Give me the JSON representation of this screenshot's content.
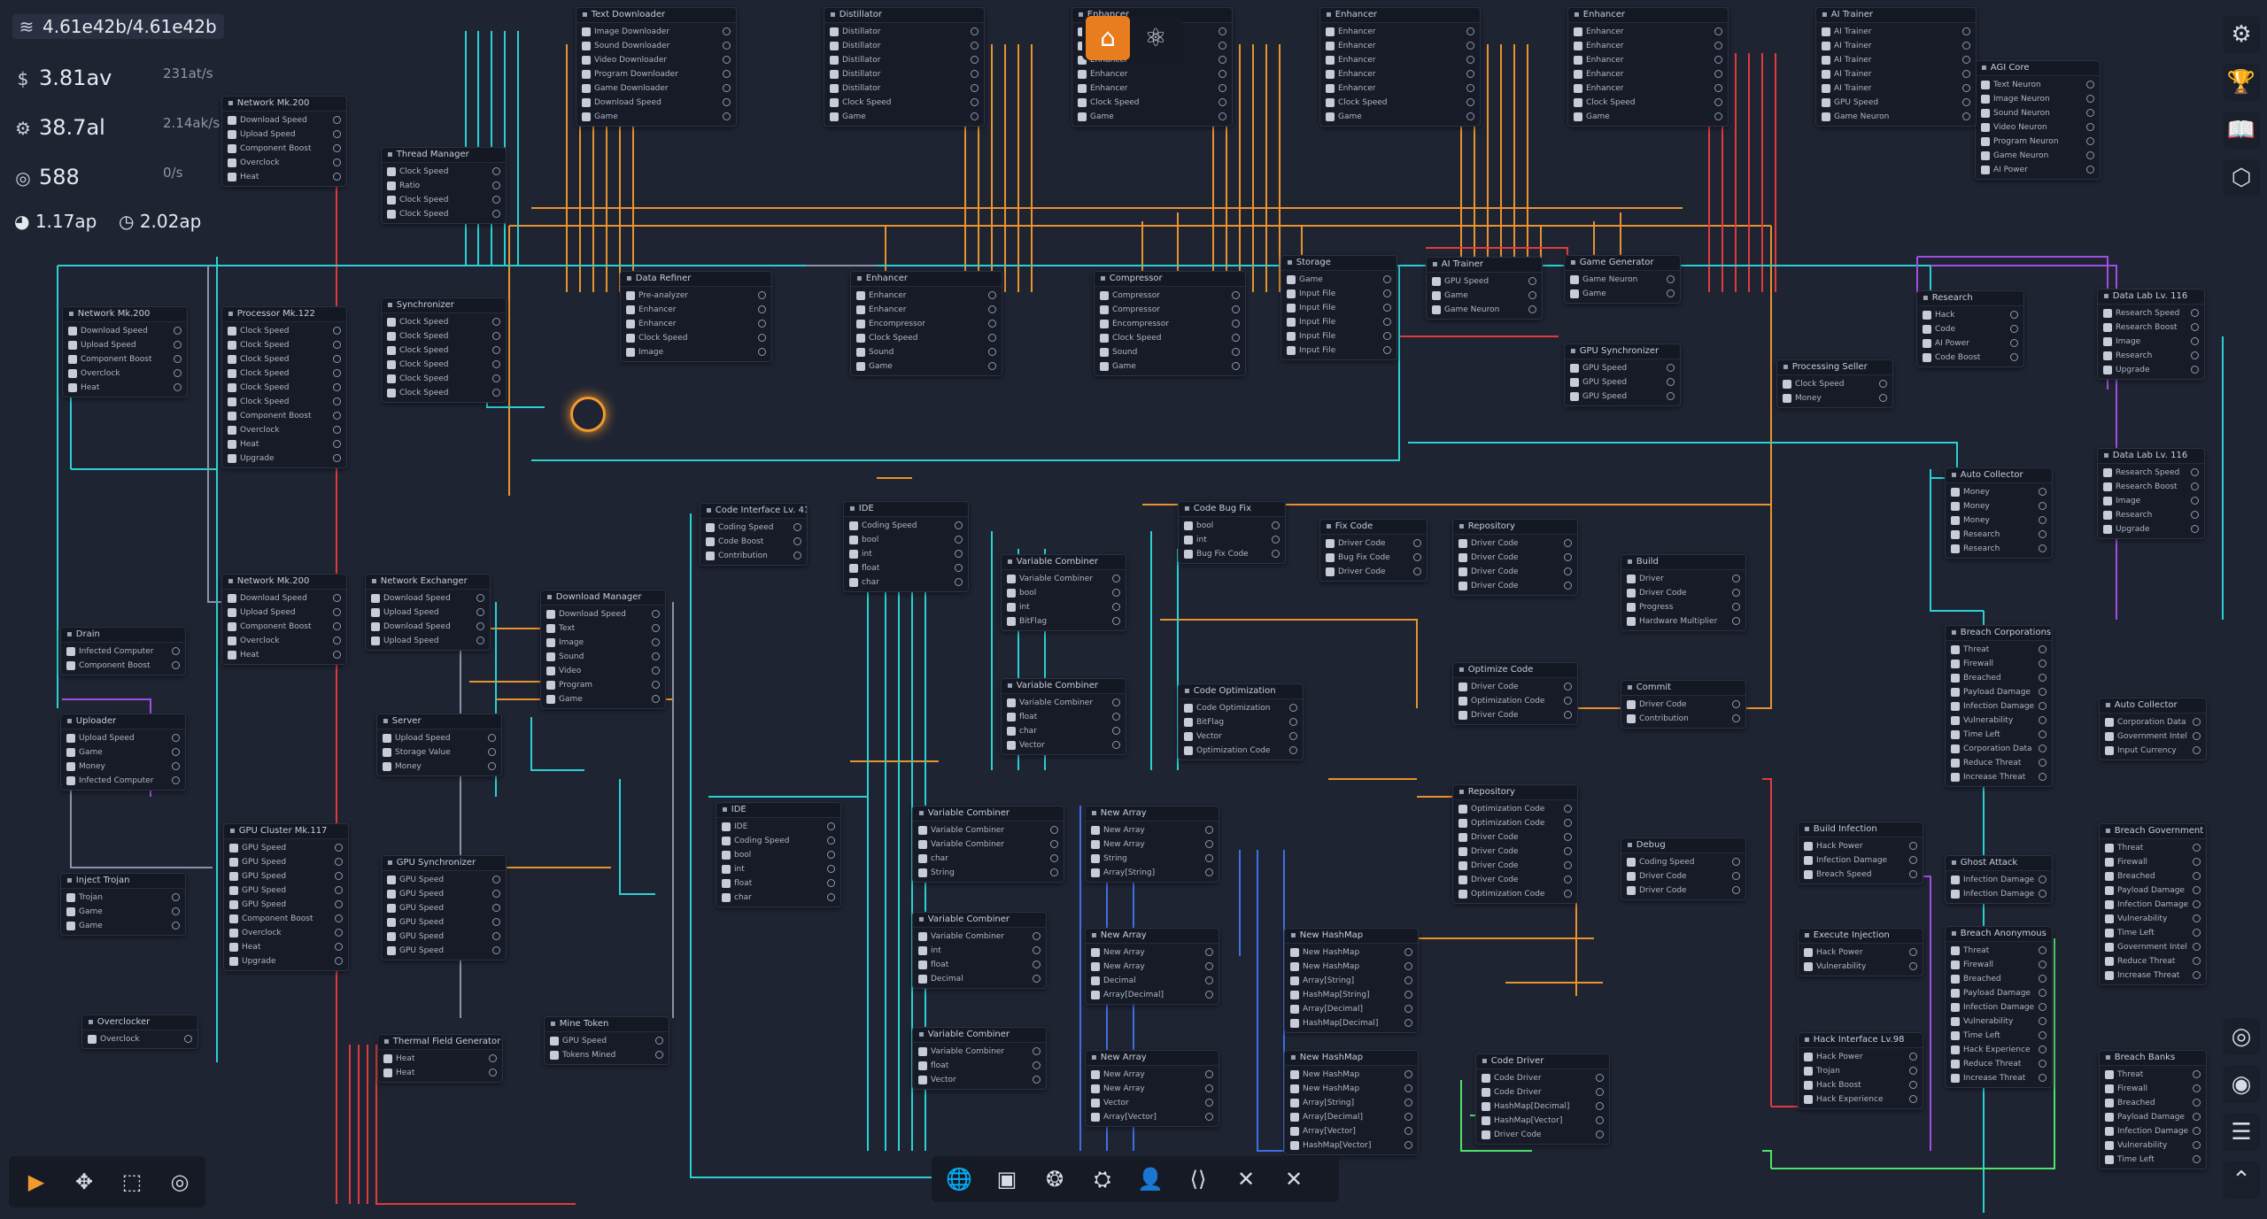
{
  "stats": {
    "data": {
      "value": "4.61e42b/4.61e42b",
      "icon": "layers-icon"
    },
    "money": {
      "value": "3.81av",
      "rate": "231at/s",
      "icon": "dollar-icon"
    },
    "research": {
      "value": "38.7al",
      "rate": "2.14ak/s",
      "icon": "gear-icon"
    },
    "tokens": {
      "value": "588",
      "rate": "0/s",
      "icon": "token-icon"
    },
    "processing": {
      "value": "1.17ap",
      "icon": "pie-icon"
    },
    "speed": {
      "value": "2.02ap",
      "icon": "clock-icon"
    }
  },
  "top_nav": [
    {
      "name": "home",
      "glyph": "⌂",
      "active": true
    },
    {
      "name": "atom",
      "glyph": "⚛",
      "active": false
    }
  ],
  "right_sidebar": [
    {
      "name": "settings-icon",
      "glyph": "⚙"
    },
    {
      "name": "trophy-icon",
      "glyph": "🏆"
    },
    {
      "name": "book-icon",
      "glyph": "📖"
    },
    {
      "name": "hexagon-icon",
      "glyph": "⬡"
    }
  ],
  "right_sidebar_bottom": [
    {
      "name": "orbit-icon",
      "glyph": "◎"
    },
    {
      "name": "target-icon",
      "glyph": "◉"
    },
    {
      "name": "stack-icon",
      "glyph": "☰"
    },
    {
      "name": "chevrons-up-icon",
      "glyph": "⌃"
    }
  ],
  "tools": [
    {
      "name": "select-tool",
      "glyph": "▶",
      "active": true
    },
    {
      "name": "move-tool",
      "glyph": "✥",
      "active": false
    },
    {
      "name": "marquee-tool",
      "glyph": "⬚",
      "active": false
    },
    {
      "name": "target-tool",
      "glyph": "◎",
      "active": false
    }
  ],
  "categories": [
    {
      "name": "globe-icon",
      "glyph": "🌐"
    },
    {
      "name": "chip-icon",
      "glyph": "▣"
    },
    {
      "name": "brain-icon",
      "glyph": "❂"
    },
    {
      "name": "satellite-icon",
      "glyph": "⛭"
    },
    {
      "name": "user-icon",
      "glyph": "👤"
    },
    {
      "name": "code-icon",
      "glyph": "⟨⟩"
    },
    {
      "name": "tools-icon",
      "glyph": "✕"
    },
    {
      "name": "close-icon",
      "glyph": "✕"
    }
  ],
  "nodes": [
    {
      "title": "Network Mk.200",
      "rows": [
        "Download Speed",
        "Upload Speed",
        "Component Boost",
        "Overclock",
        "Heat"
      ]
    },
    {
      "title": "Thread Manager",
      "rows": [
        "Clock Speed",
        "Ratio",
        "Clock Speed",
        "Clock Speed"
      ]
    },
    {
      "title": "Network Mk.200",
      "rows": [
        "Download Speed",
        "Upload Speed",
        "Component Boost",
        "Overclock",
        "Heat"
      ]
    },
    {
      "title": "Processor Mk.122",
      "rows": [
        "Clock Speed",
        "Clock Speed",
        "Clock Speed",
        "Clock Speed",
        "Clock Speed",
        "Clock Speed",
        "Component Boost",
        "Overclock",
        "Heat",
        "Upgrade"
      ]
    },
    {
      "title": "Synchronizer",
      "rows": [
        "Clock Speed",
        "Clock Speed",
        "Clock Speed",
        "Clock Speed",
        "Clock Speed",
        "Clock Speed"
      ]
    },
    {
      "title": "Network Mk.200",
      "rows": [
        "Download Speed",
        "Upload Speed",
        "Component Boost",
        "Overclock",
        "Heat"
      ]
    },
    {
      "title": "Network Exchanger",
      "rows": [
        "Download Speed",
        "Upload Speed",
        "Download Speed",
        "Upload Speed"
      ]
    },
    {
      "title": "Drain",
      "rows": [
        "Infected Computer",
        "Component Boost"
      ]
    },
    {
      "title": "Server",
      "rows": [
        "Upload Speed",
        "Storage Value",
        "Money"
      ]
    },
    {
      "title": "Uploader",
      "rows": [
        "Upload Speed",
        "Game",
        "Money",
        "Infected Computer"
      ]
    },
    {
      "title": "Download Manager",
      "rows": [
        "Download Speed",
        "Text",
        "Image",
        "Sound",
        "Video",
        "Program",
        "Game"
      ]
    },
    {
      "title": "GPU Cluster Mk.117",
      "rows": [
        "GPU Speed",
        "GPU Speed",
        "GPU Speed",
        "GPU Speed",
        "GPU Speed",
        "Component Boost",
        "Overclock",
        "Heat",
        "Upgrade"
      ]
    },
    {
      "title": "GPU Synchronizer",
      "rows": [
        "GPU Speed",
        "GPU Speed",
        "GPU Speed",
        "GPU Speed",
        "GPU Speed",
        "GPU Speed"
      ]
    },
    {
      "title": "Inject Trojan",
      "rows": [
        "Trojan",
        "Game",
        "Game"
      ]
    },
    {
      "title": "Overclocker",
      "rows": [
        "Overclock"
      ]
    },
    {
      "title": "Mine Token",
      "rows": [
        "GPU Speed",
        "Tokens Mined"
      ]
    },
    {
      "title": "Thermal Field Generator",
      "rows": [
        "Heat",
        "Heat"
      ]
    },
    {
      "title": "Data Refiner",
      "rows": [
        "Pre-analyzer",
        "Enhancer",
        "Enhancer",
        "Clock Speed",
        "Image"
      ]
    },
    {
      "title": "Enhancer",
      "rows": [
        "Enhancer",
        "Enhancer",
        "Encompressor",
        "Clock Speed",
        "Sound",
        "Game"
      ]
    },
    {
      "title": "Compressor",
      "rows": [
        "Compressor",
        "Compressor",
        "Encompressor",
        "Clock Speed",
        "Sound",
        "Game"
      ]
    },
    {
      "title": "Storage",
      "rows": [
        "Game",
        "Input File",
        "Input File",
        "Input File",
        "Input File",
        "Input File"
      ]
    },
    {
      "title": "AI Trainer",
      "rows": [
        "GPU Speed",
        "Game",
        "Game Neuron"
      ]
    },
    {
      "title": "Game Generator",
      "rows": [
        "Game Neuron",
        "Game"
      ]
    },
    {
      "title": "GPU Synchronizer",
      "rows": [
        "GPU Speed",
        "GPU Speed",
        "GPU Speed"
      ]
    },
    {
      "title": "Processing Seller",
      "rows": [
        "Clock Speed",
        "Money"
      ]
    },
    {
      "title": "Research",
      "rows": [
        "Hack",
        "Code",
        "AI Power",
        "Code Boost"
      ]
    },
    {
      "title": "Data Lab Lv. 116",
      "rows": [
        "Research Speed",
        "Research Boost",
        "Image",
        "Research",
        "Upgrade"
      ]
    },
    {
      "title": "Data Lab Lv. 116",
      "rows": [
        "Research Speed",
        "Research Boost",
        "Image",
        "Research",
        "Upgrade"
      ]
    },
    {
      "title": "AGI Core",
      "rows": [
        "Text Neuron",
        "Image Neuron",
        "Sound Neuron",
        "Video Neuron",
        "Program Neuron",
        "Game Neuron",
        "AI Power"
      ]
    },
    {
      "title": "Text Downloader",
      "rows": [
        "Image Downloader",
        "Sound Downloader",
        "Video Downloader",
        "Program Downloader",
        "Game Downloader",
        "Download Speed",
        "Game"
      ]
    },
    {
      "title": "Distillator",
      "rows": [
        "Distillator",
        "Distillator",
        "Distillator",
        "Distillator",
        "Distillator",
        "Clock Speed",
        "Game"
      ]
    },
    {
      "title": "Enhancer",
      "rows": [
        "Enhancer",
        "Enhancer",
        "Enhancer",
        "Enhancer",
        "Enhancer",
        "Clock Speed",
        "Game"
      ]
    },
    {
      "title": "Enhancer",
      "rows": [
        "Enhancer",
        "Enhancer",
        "Enhancer",
        "Enhancer",
        "Enhancer",
        "Clock Speed",
        "Game"
      ]
    },
    {
      "title": "Enhancer",
      "rows": [
        "Enhancer",
        "Enhancer",
        "Enhancer",
        "Enhancer",
        "Enhancer",
        "Clock Speed",
        "Game"
      ]
    },
    {
      "title": "AI Trainer",
      "rows": [
        "AI Trainer",
        "AI Trainer",
        "AI Trainer",
        "AI Trainer",
        "AI Trainer",
        "GPU Speed",
        "Game Neuron"
      ]
    },
    {
      "title": "Code Interface Lv. 41",
      "rows": [
        "Coding Speed",
        "Code Boost",
        "Contribution"
      ]
    },
    {
      "title": "IDE",
      "rows": [
        "Coding Speed",
        "bool",
        "int",
        "float",
        "char"
      ]
    },
    {
      "title": "Variable Combiner",
      "rows": [
        "Variable Combiner",
        "bool",
        "int",
        "BitFlag"
      ]
    },
    {
      "title": "Variable Combiner",
      "rows": [
        "Variable Combiner",
        "float",
        "char",
        "Vector"
      ]
    },
    {
      "title": "Code Bug Fix",
      "rows": [
        "bool",
        "int",
        "Bug Fix Code"
      ]
    },
    {
      "title": "Code Optimization",
      "rows": [
        "Code Optimization",
        "BitFlag",
        "Vector",
        "Optimization Code"
      ]
    },
    {
      "title": "Fix Code",
      "rows": [
        "Driver Code",
        "Bug Fix Code",
        "Driver Code"
      ]
    },
    {
      "title": "Repository",
      "rows": [
        "Driver Code",
        "Driver Code",
        "Driver Code",
        "Driver Code"
      ]
    },
    {
      "title": "Optimize Code",
      "rows": [
        "Driver Code",
        "Optimization Code",
        "Driver Code"
      ]
    },
    {
      "title": "Build",
      "rows": [
        "Driver",
        "Driver Code",
        "Progress",
        "Hardware Multiplier"
      ]
    },
    {
      "title": "Commit",
      "rows": [
        "Driver Code",
        "Contribution"
      ]
    },
    {
      "title": "Repository",
      "rows": [
        "Optimization Code",
        "Optimization Code",
        "Driver Code",
        "Driver Code",
        "Driver Code",
        "Driver Code",
        "Optimization Code"
      ]
    },
    {
      "title": "Debug",
      "rows": [
        "Coding Speed",
        "Driver Code",
        "Driver Code"
      ]
    },
    {
      "title": "IDE",
      "rows": [
        "IDE",
        "Coding Speed",
        "bool",
        "int",
        "float",
        "char"
      ]
    },
    {
      "title": "Variable Combiner",
      "rows": [
        "Variable Combiner",
        "Variable Combiner",
        "char",
        "String"
      ]
    },
    {
      "title": "Variable Combiner",
      "rows": [
        "Variable Combiner",
        "int",
        "float",
        "Decimal"
      ]
    },
    {
      "title": "Variable Combiner",
      "rows": [
        "Variable Combiner",
        "float",
        "Vector"
      ]
    },
    {
      "title": "New Array",
      "rows": [
        "New Array",
        "New Array",
        "String",
        "Array[String]"
      ]
    },
    {
      "title": "New Array",
      "rows": [
        "New Array",
        "New Array",
        "Decimal",
        "Array[Decimal]"
      ]
    },
    {
      "title": "New Array",
      "rows": [
        "New Array",
        "New Array",
        "Vector",
        "Array[Vector]"
      ]
    },
    {
      "title": "New HashMap",
      "rows": [
        "New HashMap",
        "New HashMap",
        "Array[String]",
        "HashMap[String]",
        "Array[Decimal]",
        "HashMap[Decimal]"
      ]
    },
    {
      "title": "New HashMap",
      "rows": [
        "New HashMap",
        "New HashMap",
        "Array[String]",
        "Array[Decimal]",
        "Array[Vector]",
        "HashMap[Vector]"
      ]
    },
    {
      "title": "Code Driver",
      "rows": [
        "Code Driver",
        "Code Driver",
        "HashMap[Decimal]",
        "HashMap[Vector]",
        "Driver Code"
      ]
    },
    {
      "title": "Build Infection",
      "rows": [
        "Hack Power",
        "Infection Damage",
        "Breach Speed"
      ]
    },
    {
      "title": "Ghost Attack",
      "rows": [
        "Infection Damage",
        "Infection Damage"
      ]
    },
    {
      "title": "Execute Injection",
      "rows": [
        "Hack Power",
        "Vulnerability"
      ]
    },
    {
      "title": "Hack Interface Lv.98",
      "rows": [
        "Hack Power",
        "Trojan",
        "Hack Boost",
        "Hack Experience"
      ]
    },
    {
      "title": "Auto Collector",
      "rows": [
        "Money",
        "Money",
        "Money",
        "Research",
        "Research"
      ]
    },
    {
      "title": "Breach Corporations",
      "rows": [
        "Threat",
        "Firewall",
        "Breached",
        "Payload Damage",
        "Infection Damage",
        "Vulnerability",
        "Time Left",
        "Corporation Data",
        "Reduce Threat",
        "Increase Threat"
      ]
    },
    {
      "title": "Auto Collector",
      "rows": [
        "Corporation Data",
        "Government Intel",
        "Input Currency"
      ]
    },
    {
      "title": "Breach Government",
      "rows": [
        "Threat",
        "Firewall",
        "Breached",
        "Payload Damage",
        "Infection Damage",
        "Vulnerability",
        "Time Left",
        "Government Intel",
        "Reduce Threat",
        "Increase Threat"
      ]
    },
    {
      "title": "Breach Anonymous",
      "rows": [
        "Threat",
        "Firewall",
        "Breached",
        "Payload Damage",
        "Infection Damage",
        "Vulnerability",
        "Time Left",
        "Hack Experience",
        "Reduce Threat",
        "Increase Threat"
      ]
    },
    {
      "title": "Breach Banks",
      "rows": [
        "Threat",
        "Firewall",
        "Breached",
        "Payload Damage",
        "Infection Damage",
        "Vulnerability",
        "Time Left"
      ]
    }
  ]
}
